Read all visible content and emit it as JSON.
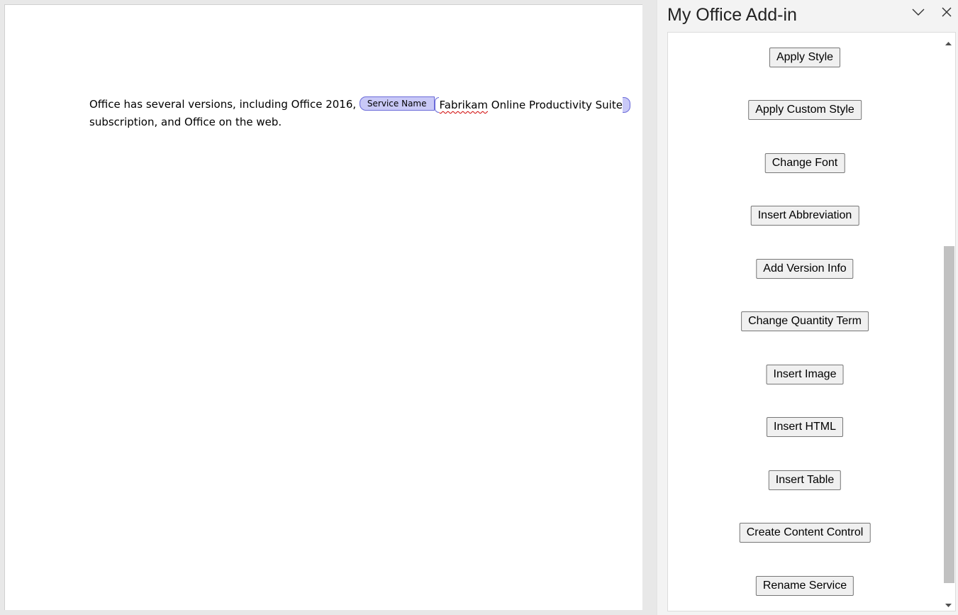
{
  "document": {
    "text_before": "Office has several versions, including Office 2016, ",
    "content_control": {
      "tag_label": "Service Name",
      "content_spell": "Fabrikam",
      "content_rest": " Online Productivity Suite"
    },
    "text_after": "subscription, and Office on the web."
  },
  "taskpane": {
    "title": "My Office Add-in",
    "icons": {
      "collapse": "chevron-down-icon",
      "close": "close-icon"
    },
    "buttons": [
      "Apply Style",
      "Apply Custom Style",
      "Change Font",
      "Insert Abbreviation",
      "Add Version Info",
      "Change Quantity Term",
      "Insert Image",
      "Insert HTML",
      "Insert Table",
      "Create Content Control",
      "Rename Service"
    ]
  },
  "colors": {
    "content_control_fill": "#c9c9f7",
    "content_control_border": "#6a6ad8",
    "spellcheck": "#d00000"
  }
}
